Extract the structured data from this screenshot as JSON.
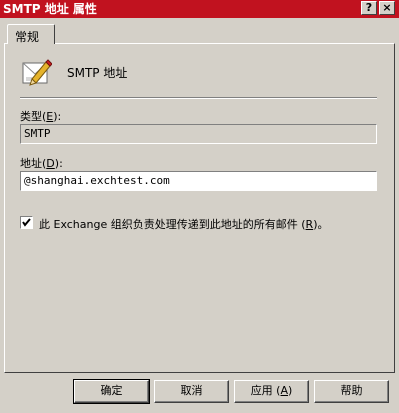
{
  "window": {
    "title": "SMTP 地址 属性",
    "help_glyph": "?",
    "close_glyph": "×"
  },
  "tabs": [
    {
      "label": "常规"
    }
  ],
  "header": {
    "icon": "address-edit-icon",
    "label": "SMTP 地址"
  },
  "type_field": {
    "label": "类型",
    "hotkey": "E",
    "value": "SMTP"
  },
  "address_field": {
    "label": "地址",
    "hotkey": "D",
    "value": "@shanghai.exchtest.com"
  },
  "checkbox": {
    "checked": true,
    "label_prefix": "此 Exchange 组织负责处理传递到此地址的所有邮件 (",
    "hotkey": "R",
    "label_suffix": ")。"
  },
  "buttons": {
    "ok": "确定",
    "cancel": "取消",
    "apply_prefix": "应用 (",
    "apply_hotkey": "A",
    "apply_suffix": ")",
    "help": "帮助"
  },
  "colors": {
    "titlebar": "#c1121f",
    "face": "#d4d0c8"
  }
}
